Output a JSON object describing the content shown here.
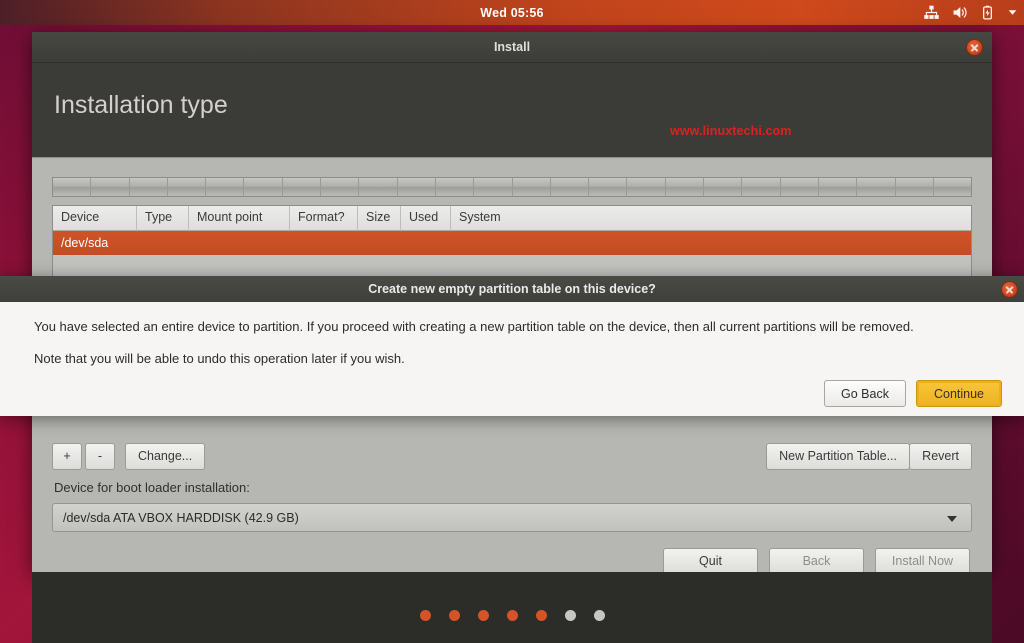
{
  "panel": {
    "clock": "Wed 05:56",
    "indicators": [
      {
        "name": "network-icon",
        "label": "Network"
      },
      {
        "name": "volume-icon",
        "label": "Volume"
      },
      {
        "name": "battery-icon",
        "label": "Battery"
      },
      {
        "name": "chevron-down-icon",
        "label": "Session menu"
      }
    ]
  },
  "window": {
    "title": "Install",
    "page_title": "Installation type",
    "watermark": "www.linuxtechi.com",
    "close_label": "Close"
  },
  "partition_table": {
    "columns": [
      "Device",
      "Type",
      "Mount point",
      "Format?",
      "Size",
      "Used",
      "System"
    ],
    "rows": [
      {
        "device": "/dev/sda",
        "type": "",
        "mount_point": "",
        "format": "",
        "size": "",
        "used": "",
        "system": "",
        "selected": true
      }
    ],
    "segment_count": 24
  },
  "partition_tools": {
    "add": "+",
    "remove": "-",
    "change": "Change...",
    "new_partition_table": "New Partition Table...",
    "revert": "Revert"
  },
  "bootloader": {
    "label": "Device for boot loader installation:",
    "selected": "/dev/sda ATA VBOX HARDDISK (42.9 GB)"
  },
  "nav": {
    "quit": "Quit",
    "back": "Back",
    "install_now": "Install Now"
  },
  "slideshow": {
    "dots_total": 7,
    "dots_active": 5
  },
  "dialog": {
    "title": "Create new empty partition table on this device?",
    "paragraph1": "You have selected an entire device to partition. If you proceed with creating a new partition table on the device, then all current partitions will be removed.",
    "paragraph2": "Note that you will be able to undo this operation later if you wish.",
    "go_back": "Go Back",
    "continue": "Continue",
    "close_label": "Close"
  },
  "colors": {
    "accent_orange": "#d55327",
    "selection_orange": "#c44c23",
    "continue_yellow": "#eeb21e",
    "watermark_red": "#e02020",
    "panel_dark": "#3b3b37",
    "body_grey": "#b6b6b3"
  }
}
